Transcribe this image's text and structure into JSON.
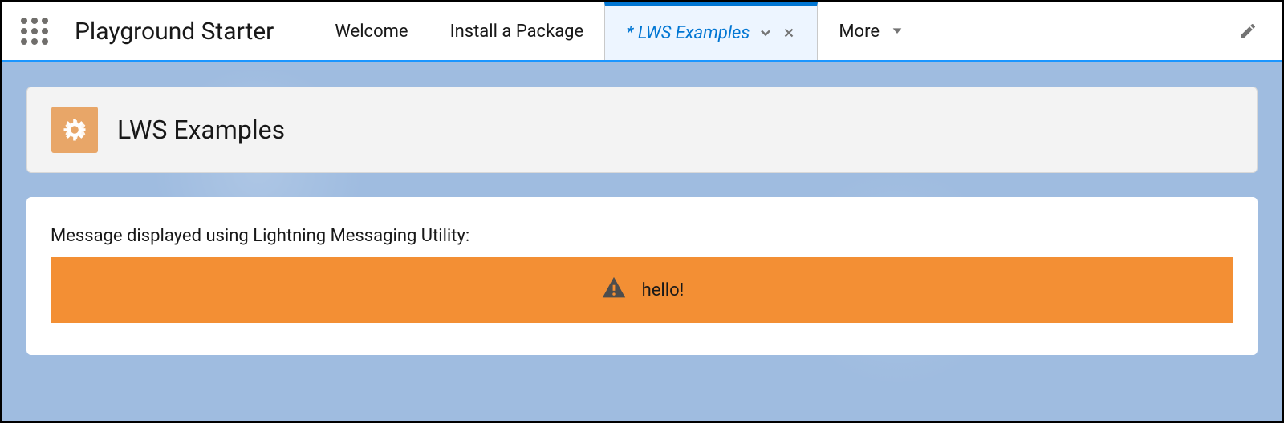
{
  "app": {
    "name": "Playground Starter"
  },
  "nav": {
    "tabs": [
      {
        "label": "Welcome",
        "active": false
      },
      {
        "label": "Install a Package",
        "active": false
      },
      {
        "label": "LWS Examples",
        "active": true,
        "unsaved": true
      }
    ],
    "more_label": "More"
  },
  "page": {
    "title": "LWS Examples",
    "message_label": "Message displayed using Lightning Messaging Utility:",
    "alert_text": "hello!"
  },
  "colors": {
    "brand_blue": "#0176d3",
    "accent_orange": "#f38f34",
    "icon_tile": "#e8a668",
    "body_bg": "#9fbce0"
  }
}
